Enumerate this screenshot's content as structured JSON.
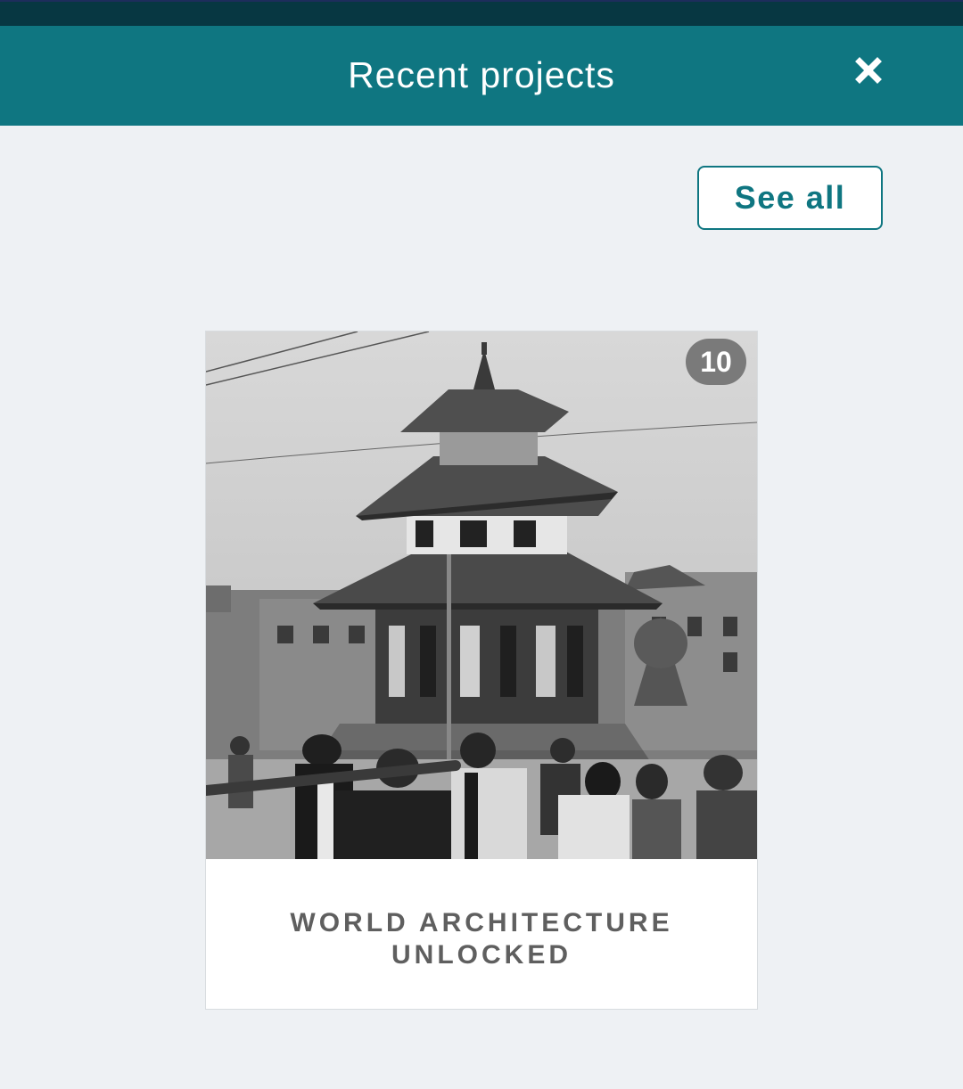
{
  "header": {
    "title": "Recent projects",
    "close_icon": "close-icon"
  },
  "actions": {
    "see_all_label": "See all"
  },
  "projects": [
    {
      "name": "WORLD ARCHITECTURE UNLOCKED",
      "count": "10",
      "image": "black-and-white photo of a multi-tiered pagoda temple in a busy square"
    }
  ],
  "colors": {
    "header_bg": "#0f7681",
    "top_strip": "#073742",
    "page_bg": "#eef1f4",
    "accent": "#0f7681",
    "badge_bg": "#7a7a7a",
    "card_text": "#5f5f5f"
  }
}
